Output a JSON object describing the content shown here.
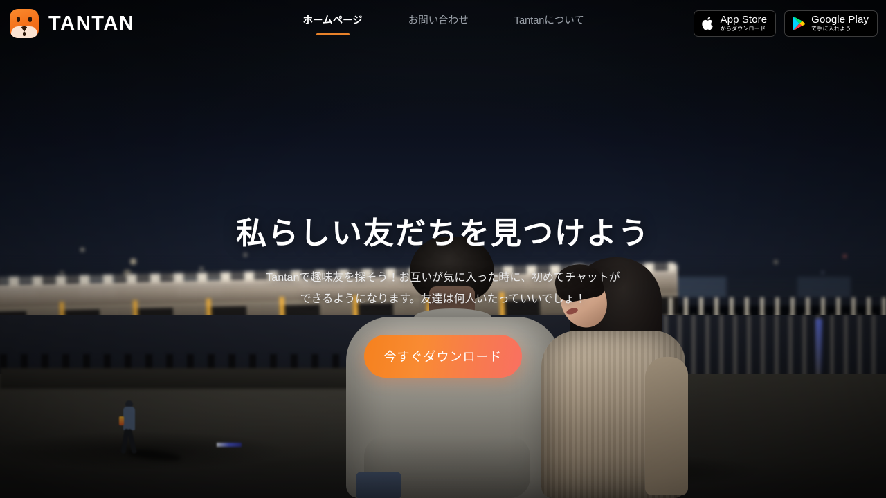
{
  "header": {
    "logo_icon": "fox-logo-icon",
    "brand_name": "TANTAN",
    "nav": [
      {
        "label": "ホームページ",
        "active": true
      },
      {
        "label": "お問い合わせ",
        "active": false
      },
      {
        "label": "Tantanについて",
        "active": false
      }
    ],
    "stores": [
      {
        "icon": "apple-icon",
        "main": "App Store",
        "sub": "からダウンロード"
      },
      {
        "icon": "google-play-icon",
        "main": "Google Play",
        "sub": "で手に入れよう"
      }
    ]
  },
  "hero": {
    "title": "私らしい友だちを見つけよう",
    "description": "Tantanで趣味友を探そう！お互いが気に入った時に、初めてチャットができるようになります。友達は何人いたっていいでしょ！",
    "cta_label": "今すぐダウンロード"
  },
  "colors": {
    "accent_orange": "#e8822a",
    "cta_gradient_start": "#f5811e",
    "cta_gradient_end": "#f97061",
    "brand_logo_orange": "#f4711a",
    "nav_inactive": "#9aa0a8",
    "text_white": "#ffffff",
    "sky_top": "#080b11",
    "sky_bottom": "#20232c"
  },
  "background": {
    "scene": "night-riverside-bridge-with-couple"
  }
}
